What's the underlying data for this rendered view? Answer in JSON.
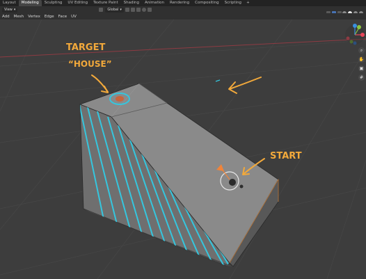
{
  "tabs": [
    {
      "label": "Layout"
    },
    {
      "label": "Modeling"
    },
    {
      "label": "Sculpting"
    },
    {
      "label": "UV Editing"
    },
    {
      "label": "Texture Paint"
    },
    {
      "label": "Shading"
    },
    {
      "label": "Animation"
    },
    {
      "label": "Rendering"
    },
    {
      "label": "Compositing"
    },
    {
      "label": "Scripting"
    }
  ],
  "active_tab": "Modeling",
  "add_tab": "+",
  "header": {
    "view_dropdown": "View",
    "orientation": "Global"
  },
  "menu": [
    {
      "label": "Add"
    },
    {
      "label": "Mesh"
    },
    {
      "label": "Vertex"
    },
    {
      "label": "Edge"
    },
    {
      "label": "Face"
    },
    {
      "label": "UV"
    }
  ],
  "annotations": {
    "target_line1": "TARGET",
    "target_line2": "“HOUSE”",
    "start": "START"
  },
  "colors": {
    "accent": "#4772b3",
    "annotation": "#f2a93b",
    "hatch": "#35c6de",
    "axis_x": "#e8465a",
    "axis_y": "#8cc63f",
    "axis_z": "#3a8fe0"
  },
  "icons": {
    "gizmo": "navigation-gizmo-icon",
    "zoom": "zoom-icon",
    "hand": "pan-hand-icon",
    "camera": "camera-icon",
    "grid": "grid-icon"
  }
}
